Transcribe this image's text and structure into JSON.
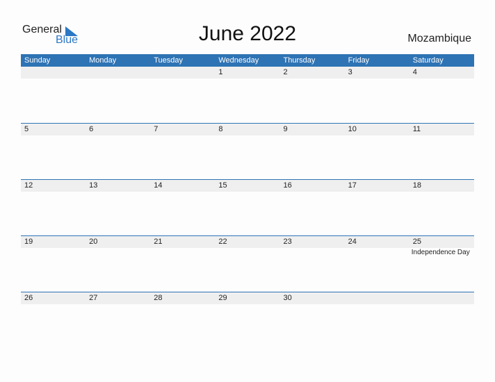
{
  "logo": {
    "general": "General",
    "blue": "Blue",
    "brand_color": "#2b78c5"
  },
  "title": "June 2022",
  "country": "Mozambique",
  "header_color": "#2e73b4",
  "weekdays": [
    "Sunday",
    "Monday",
    "Tuesday",
    "Wednesday",
    "Thursday",
    "Friday",
    "Saturday"
  ],
  "weeks": [
    {
      "days": [
        "",
        "",
        "",
        "1",
        "2",
        "3",
        "4"
      ],
      "events": [
        "",
        "",
        "",
        "",
        "",
        "",
        ""
      ]
    },
    {
      "days": [
        "5",
        "6",
        "7",
        "8",
        "9",
        "10",
        "11"
      ],
      "events": [
        "",
        "",
        "",
        "",
        "",
        "",
        ""
      ]
    },
    {
      "days": [
        "12",
        "13",
        "14",
        "15",
        "16",
        "17",
        "18"
      ],
      "events": [
        "",
        "",
        "",
        "",
        "",
        "",
        ""
      ]
    },
    {
      "days": [
        "19",
        "20",
        "21",
        "22",
        "23",
        "24",
        "25"
      ],
      "events": [
        "",
        "",
        "",
        "",
        "",
        "",
        "Independence Day"
      ]
    },
    {
      "days": [
        "26",
        "27",
        "28",
        "29",
        "30",
        "",
        ""
      ],
      "events": [
        "",
        "",
        "",
        "",
        "",
        "",
        ""
      ]
    }
  ]
}
